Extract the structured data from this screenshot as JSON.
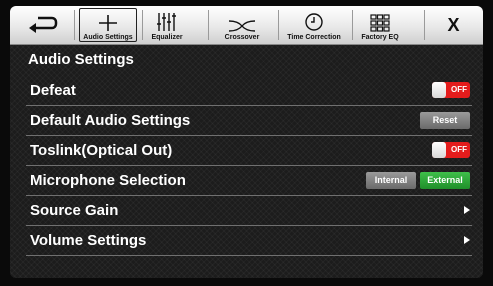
{
  "tabs": [
    {
      "label": "",
      "icon": "back-icon"
    },
    {
      "label": "Audio Settings",
      "icon": "crosshair-icon",
      "active": true
    },
    {
      "label": "Equalizer",
      "icon": "equalizer-icon"
    },
    {
      "label": "Crossover",
      "icon": "crossover-icon"
    },
    {
      "label": "Time Correction",
      "icon": "clock-icon"
    },
    {
      "label": "Factory EQ",
      "icon": "grid-icon"
    },
    {
      "label": "X",
      "icon": "close-icon"
    }
  ],
  "page_title": "Audio Settings",
  "rows": {
    "defeat": {
      "label": "Defeat",
      "toggle": "OFF"
    },
    "default_audio": {
      "label": "Default Audio Settings",
      "button": "Reset"
    },
    "toslink": {
      "label": "Toslink(Optical Out)",
      "toggle": "OFF"
    },
    "microphone": {
      "label": "Microphone Selection",
      "option_internal": "Internal",
      "option_external": "External",
      "selected": "External"
    },
    "source_gain": {
      "label": "Source Gain"
    },
    "volume": {
      "label": "Volume Settings"
    }
  },
  "colors": {
    "toggle_off": "#e41c1c",
    "selected": "#2ea83a",
    "unselected": "#808080"
  }
}
